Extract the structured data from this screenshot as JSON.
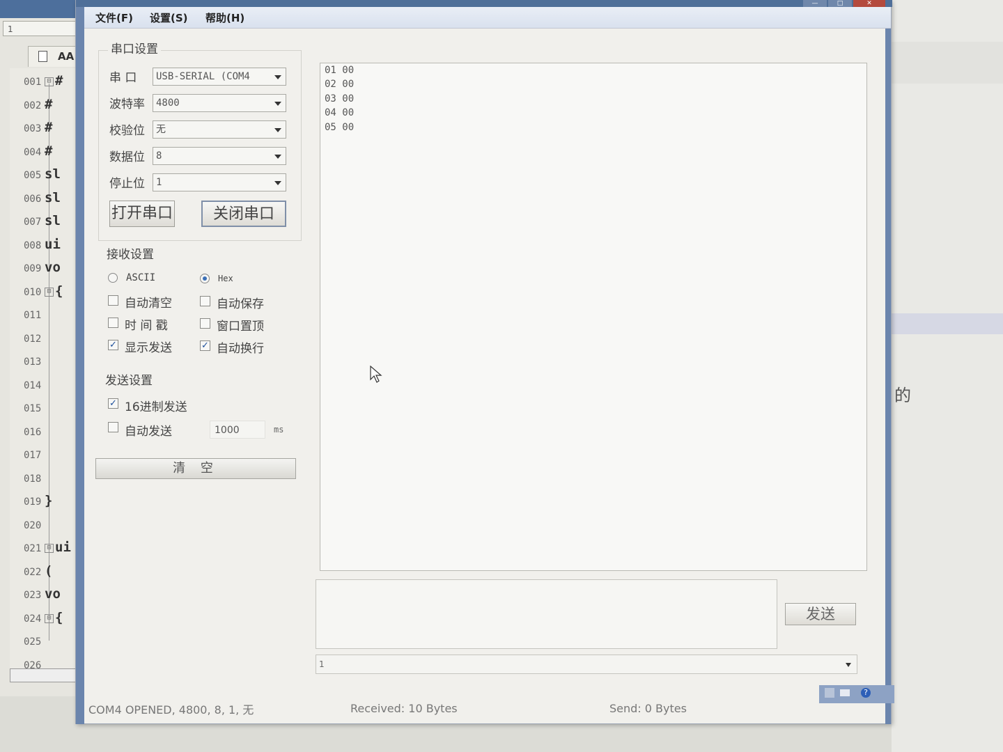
{
  "editor": {
    "line_box": "1",
    "tab_label": "AA",
    "lines": [
      {
        "num": "001",
        "fold": "⊟",
        "code": "#"
      },
      {
        "num": "002",
        "fold": "",
        "code": "#"
      },
      {
        "num": "003",
        "fold": "",
        "code": "#"
      },
      {
        "num": "004",
        "fold": "",
        "code": "#"
      },
      {
        "num": "005",
        "fold": "",
        "code": "sl"
      },
      {
        "num": "006",
        "fold": "",
        "code": "sl"
      },
      {
        "num": "007",
        "fold": "",
        "code": "sl"
      },
      {
        "num": "008",
        "fold": "",
        "code": "ui"
      },
      {
        "num": "009",
        "fold": "",
        "code": "vo"
      },
      {
        "num": "010",
        "fold": "⊟",
        "code": "{"
      },
      {
        "num": "011",
        "fold": "",
        "code": ""
      },
      {
        "num": "012",
        "fold": "",
        "code": ""
      },
      {
        "num": "013",
        "fold": "",
        "code": ""
      },
      {
        "num": "014",
        "fold": "",
        "code": ""
      },
      {
        "num": "015",
        "fold": "",
        "code": ""
      },
      {
        "num": "016",
        "fold": "",
        "code": ""
      },
      {
        "num": "017",
        "fold": "",
        "code": ""
      },
      {
        "num": "018",
        "fold": "",
        "code": ""
      },
      {
        "num": "019",
        "fold": "",
        "code": "}"
      },
      {
        "num": "020",
        "fold": "",
        "code": ""
      },
      {
        "num": "021",
        "fold": "⊟",
        "code": "ui"
      },
      {
        "num": "022",
        "fold": "",
        "code": "("
      },
      {
        "num": "023",
        "fold": "",
        "code": "vo"
      },
      {
        "num": "024",
        "fold": "⊟",
        "code": "{"
      },
      {
        "num": "025",
        "fold": "",
        "code": ""
      },
      {
        "num": "026",
        "fold": "",
        "code": ""
      }
    ]
  },
  "right_doc": {
    "text": "的"
  },
  "menu": {
    "file": "文件(F)",
    "settings": "设置(S)",
    "help": "帮助(H)"
  },
  "port_settings": {
    "title": "串口设置",
    "port_label": "串  口",
    "port_value": "USB-SERIAL  (COM4",
    "baud_label": "波特率",
    "baud_value": "4800",
    "parity_label": "校验位",
    "parity_value": "无",
    "databits_label": "数据位",
    "databits_value": "8",
    "stopbits_label": "停止位",
    "stopbits_value": "1",
    "open_button": "打开串口",
    "close_button": "关闭串口"
  },
  "receive_settings": {
    "title": "接收设置",
    "ascii": "ASCII",
    "hex": "Hex",
    "mode": "hex",
    "auto_clear": "自动清空",
    "auto_clear_checked": false,
    "auto_save": "自动保存",
    "auto_save_checked": false,
    "timestamp": "时 间 戳",
    "timestamp_checked": false,
    "window_top": "窗口置顶",
    "window_top_checked": false,
    "show_send": "显示发送",
    "show_send_checked": true,
    "auto_wrap": "自动换行",
    "auto_wrap_checked": true
  },
  "send_settings": {
    "title": "发送设置",
    "hex_send": "16进制发送",
    "hex_send_checked": true,
    "auto_send": "自动发送",
    "auto_send_checked": false,
    "interval": "1000",
    "interval_unit": "ms"
  },
  "clear_button": "清 空",
  "receive_lines": [
    "01 00",
    "02 00",
    "03 00",
    "04 00",
    "05 00"
  ],
  "send_button": "发送",
  "history_value": "1",
  "status": {
    "port": "COM4 OPENED, 4800, 8, 1, 无",
    "received": "Received: 10 Bytes",
    "sent": "Send: 0 Bytes"
  },
  "check_mark": "✓"
}
